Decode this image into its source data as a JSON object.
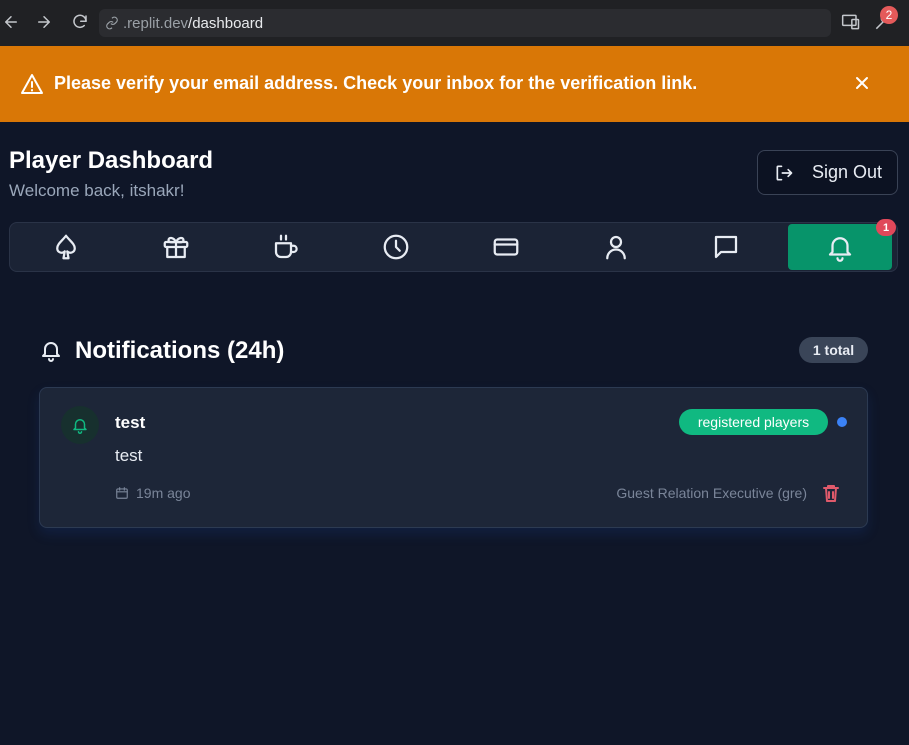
{
  "browser": {
    "url_domain": ".replit.dev",
    "url_path": "/dashboard",
    "extension_badge": "2",
    "icons": [
      "back-arrow-icon",
      "forward-arrow-icon",
      "reload-icon",
      "link-icon",
      "devices-icon",
      "extension-icon"
    ]
  },
  "banner": {
    "message": "Please verify your email address. Check your inbox for the verification link.",
    "color": "#d97706",
    "icons": [
      "warning-triangle-icon",
      "close-icon"
    ]
  },
  "header": {
    "title": "Player Dashboard",
    "subtitle": "Welcome back, itshakr!",
    "sign_out_label": "Sign Out"
  },
  "tabs": {
    "items": [
      {
        "icon": "spade-icon"
      },
      {
        "icon": "gift-icon"
      },
      {
        "icon": "coffee-icon"
      },
      {
        "icon": "clock-icon"
      },
      {
        "icon": "credit-card-icon"
      },
      {
        "icon": "user-icon"
      },
      {
        "icon": "message-icon"
      },
      {
        "icon": "bell-icon",
        "active": true,
        "badge": "1"
      }
    ],
    "active_color": "#07946a"
  },
  "notifications": {
    "title": "Notifications (24h)",
    "total_label": "1 total",
    "items": [
      {
        "title": "test",
        "body": "test",
        "audience": "registered players",
        "time": "19m ago",
        "sender": "Guest Relation Executive (gre)",
        "unread": true
      }
    ]
  }
}
